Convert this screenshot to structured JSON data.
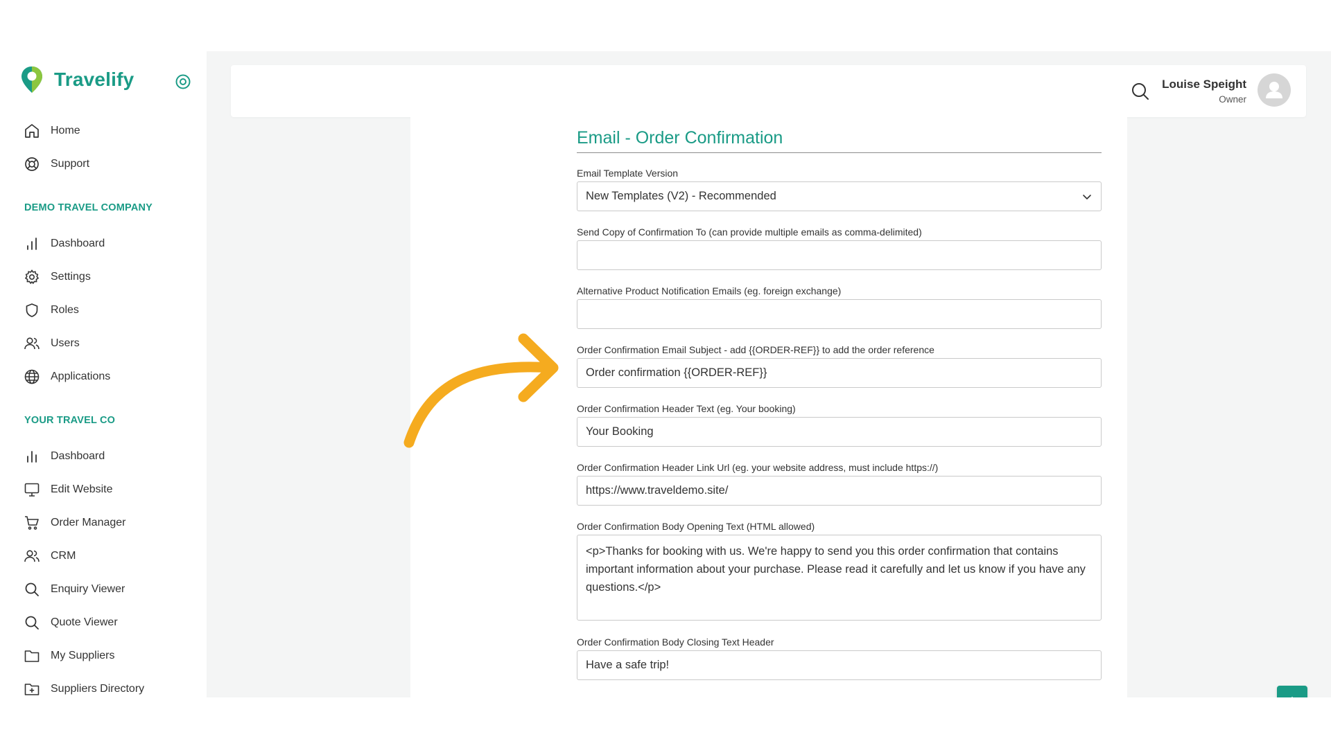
{
  "brand": {
    "name": "Travelify"
  },
  "sidebar": {
    "top_items": [
      {
        "label": "Home",
        "icon": "home-icon"
      },
      {
        "label": "Support",
        "icon": "support-icon"
      }
    ],
    "section1": {
      "title": "DEMO TRAVEL COMPANY",
      "items": [
        {
          "label": "Dashboard",
          "icon": "bar-chart-icon"
        },
        {
          "label": "Settings",
          "icon": "gear-icon"
        },
        {
          "label": "Roles",
          "icon": "shield-icon"
        },
        {
          "label": "Users",
          "icon": "users-icon"
        },
        {
          "label": "Applications",
          "icon": "globe-icon"
        }
      ]
    },
    "section2": {
      "title": "YOUR TRAVEL CO",
      "items": [
        {
          "label": "Dashboard",
          "icon": "bar-chart-icon"
        },
        {
          "label": "Edit Website",
          "icon": "monitor-icon"
        },
        {
          "label": "Order Manager",
          "icon": "cart-icon"
        },
        {
          "label": "CRM",
          "icon": "users-icon"
        },
        {
          "label": "Enquiry Viewer",
          "icon": "search-icon"
        },
        {
          "label": "Quote Viewer",
          "icon": "search-icon"
        },
        {
          "label": "My Suppliers",
          "icon": "folder-icon"
        },
        {
          "label": "Suppliers Directory",
          "icon": "folder-plus-icon"
        }
      ]
    }
  },
  "header": {
    "user_name": "Louise Speight",
    "user_role": "Owner"
  },
  "form": {
    "title": "Email - Order Confirmation",
    "fields": [
      {
        "label": "Email Template Version",
        "value": "New Templates (V2) - Recommended"
      },
      {
        "label": "Send Copy of Confirmation To (can provide multiple emails as comma-delimited)",
        "value": ""
      },
      {
        "label": "Alternative Product Notification Emails (eg. foreign exchange)",
        "value": ""
      },
      {
        "label": "Order Confirmation Email Subject - add {{ORDER-REF}} to add the order reference",
        "value": "Order confirmation {{ORDER-REF}}"
      },
      {
        "label": "Order Confirmation Header Text (eg. Your booking)",
        "value": "Your Booking"
      },
      {
        "label": "Order Confirmation Header Link Url (eg. your website address, must include https://)",
        "value": "https://www.traveldemo.site/"
      },
      {
        "label": "Order Confirmation Body Opening Text (HTML allowed)",
        "value": "<p>Thanks for booking with us. We're happy to send you this order confirmation that contains important information about your purchase. Please read it carefully and let us know if you have any questions.</p>"
      },
      {
        "label": "Order Confirmation Body Closing Text Header",
        "value": "Have a safe trip!"
      }
    ]
  },
  "colors": {
    "accent": "#1a9b86",
    "arrow": "#f5ab1f"
  }
}
